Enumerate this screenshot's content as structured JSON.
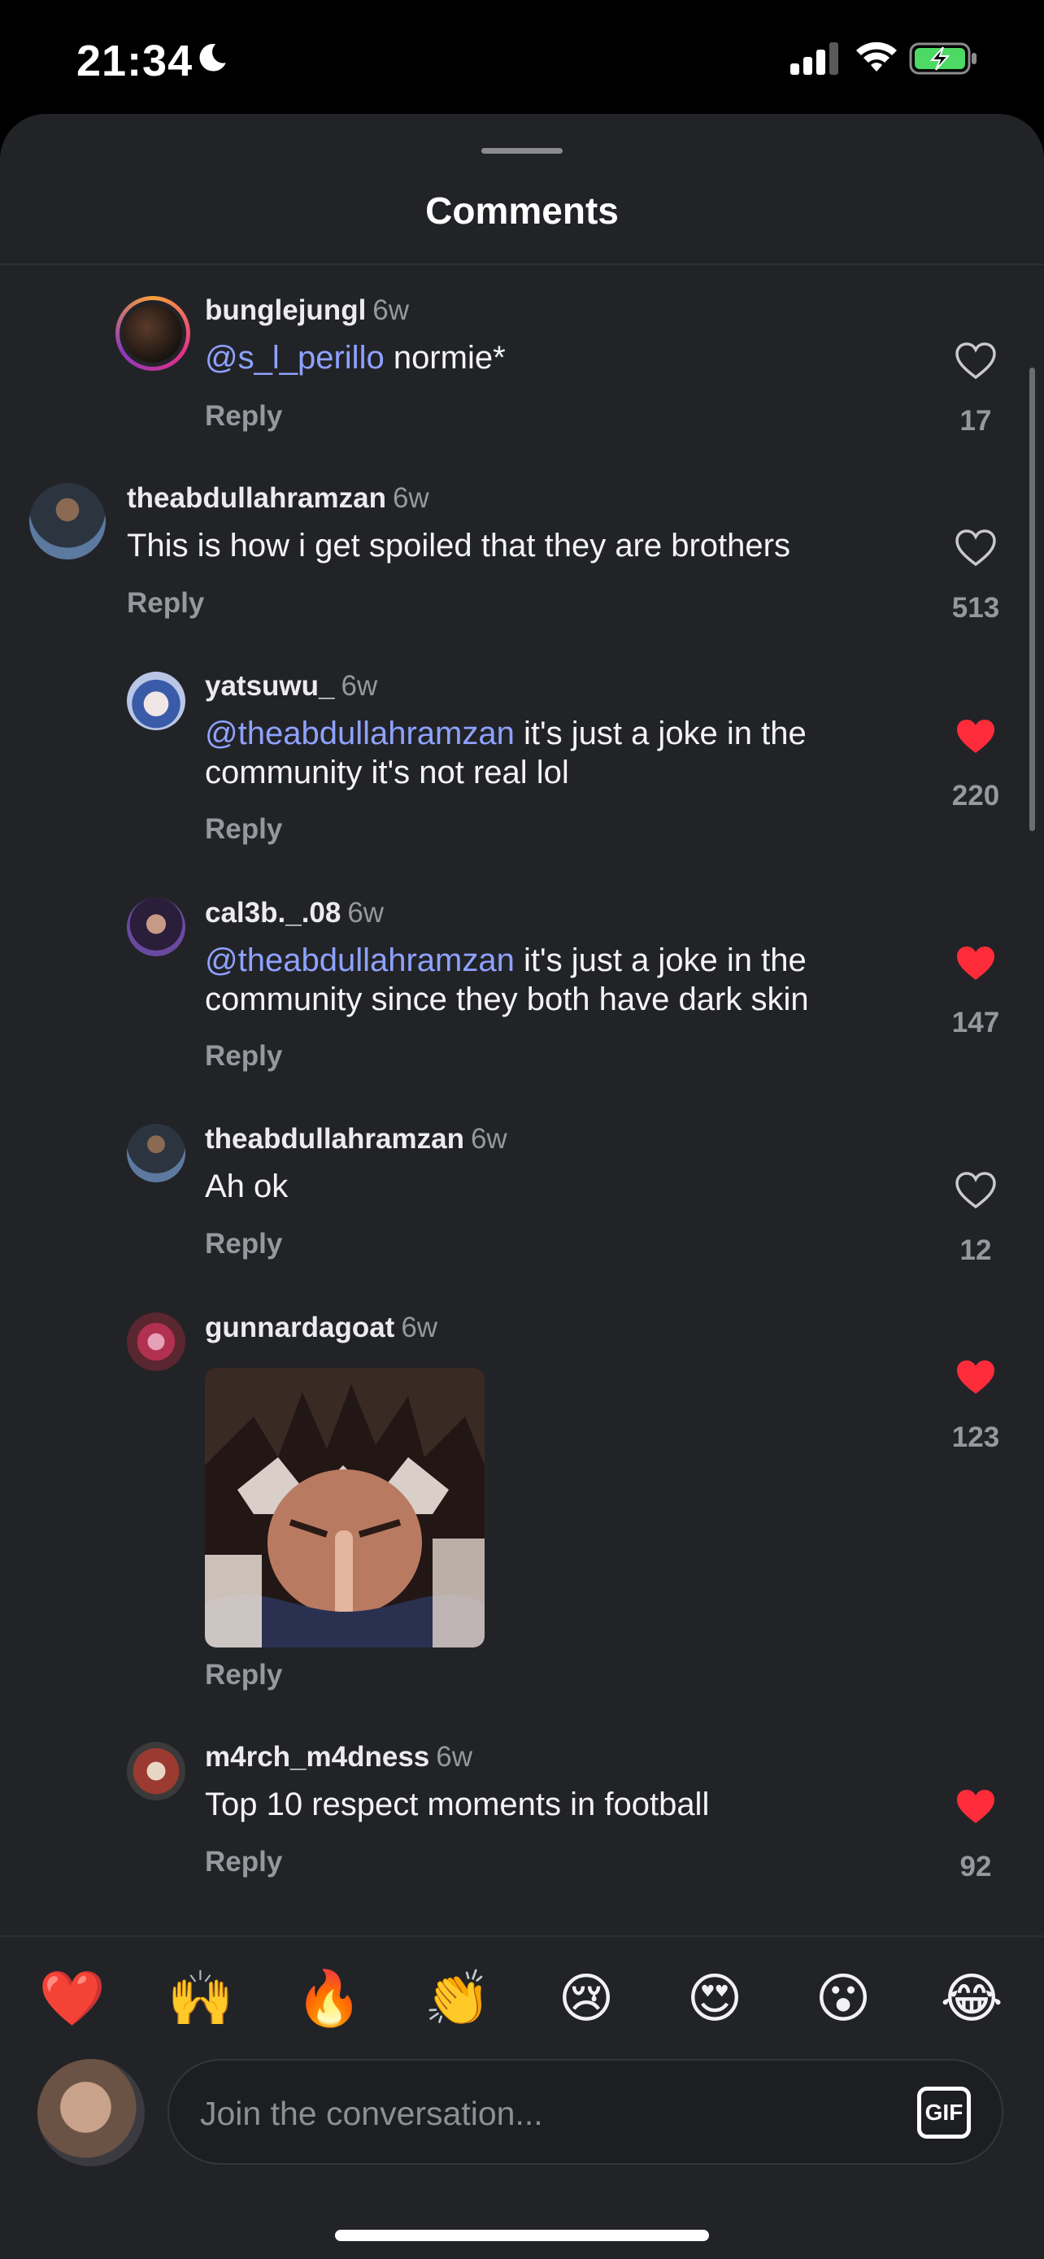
{
  "status": {
    "time": "21:34"
  },
  "sheet": {
    "title": "Comments"
  },
  "comments": [
    {
      "username": "bunglejungl",
      "age": "6w",
      "mention": "@s_l_perillo",
      "text": " normie*",
      "reply": "Reply",
      "likes": "17",
      "liked": false
    },
    {
      "username": "theabdullahramzan",
      "age": "6w",
      "mention": "",
      "text": "This is how i get spoiled that they are brothers",
      "reply": "Reply",
      "likes": "513",
      "liked": false
    },
    {
      "username": "yatsuwu_",
      "age": "6w",
      "mention": "@theabdullahramzan",
      "text": " it's just a joke in the community it's not real lol",
      "reply": "Reply",
      "likes": "220",
      "liked": true
    },
    {
      "username": "cal3b._.08",
      "age": "6w",
      "mention": "@theabdullahramzan",
      "text": " it's just a joke in the community since they both have dark skin",
      "reply": "Reply",
      "likes": "147",
      "liked": true
    },
    {
      "username": "theabdullahramzan",
      "age": "6w",
      "mention": "",
      "text": "Ah ok",
      "reply": "Reply",
      "likes": "12",
      "liked": false
    },
    {
      "username": "gunnardagoat",
      "age": "6w",
      "mention": "",
      "text": "",
      "reply": "Reply",
      "likes": "123",
      "liked": true
    },
    {
      "username": "m4rch_m4dness",
      "age": "6w",
      "mention": "",
      "text": "Top 10 respect moments in football",
      "reply": "Reply",
      "likes": "92",
      "liked": true
    }
  ],
  "reactions": [
    "❤️",
    "🙌",
    "🔥",
    "👏",
    "😢",
    "😍",
    "😮",
    "😂"
  ],
  "composer": {
    "placeholder": "Join the conversation...",
    "gif_label": "GIF"
  },
  "colors": {
    "mention": "#8ea2ff",
    "liked": "#fe2c3a",
    "background": "#222327"
  }
}
